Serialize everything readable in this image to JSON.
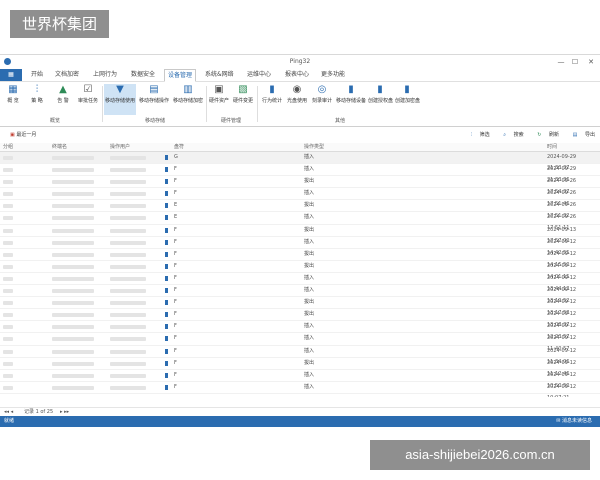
{
  "watermark_top": "世界杯集团",
  "watermark_bottom": "asia-shijiebei2026.com.cn",
  "window": {
    "title": "Ping32",
    "minimize": "—",
    "maximize": "☐",
    "close": "✕"
  },
  "menu": {
    "file_icon": "grid-icon",
    "tabs": [
      "开始",
      "文档加密",
      "上网行为",
      "数据安全",
      "设备管理",
      "系统&网络",
      "运维中心",
      "报表中心",
      "更多功能"
    ]
  },
  "ribbon": {
    "buttons": [
      {
        "label": "概 览",
        "icon": "▦",
        "color": "#2b6cb0"
      },
      {
        "label": "策 略",
        "icon": "⫶",
        "color": "#2b6cb0"
      },
      {
        "label": "告 警",
        "icon": "▲",
        "color": "#2e8b57"
      },
      {
        "label": "审批任务",
        "icon": "☑",
        "color": "#555555"
      },
      {
        "label": "移动存储使用",
        "icon": "▼",
        "color": "#2b6cb0"
      },
      {
        "label": "移动存储操作",
        "icon": "▤",
        "color": "#2b6cb0"
      },
      {
        "label": "移动存储加密",
        "icon": "▥",
        "color": "#2b6cb0"
      },
      {
        "label": "硬件资产",
        "icon": "▣",
        "color": "#555555"
      },
      {
        "label": "硬件变更",
        "icon": "▧",
        "color": "#2e8b57"
      },
      {
        "label": "行为统计",
        "icon": "▮",
        "color": "#2b6cb0"
      },
      {
        "label": "光盘使用",
        "icon": "◉",
        "color": "#555555"
      },
      {
        "label": "刻录审计",
        "icon": "◎",
        "color": "#2b6cb0"
      },
      {
        "label": "移动存储设备",
        "icon": "▮",
        "color": "#2b6cb0"
      },
      {
        "label": "创建授权盘",
        "icon": "▮",
        "color": "#2b6cb0"
      },
      {
        "label": "创建加密盘",
        "icon": "▮",
        "color": "#2b6cb0"
      }
    ],
    "groups": [
      "概览",
      "移动存储",
      "硬件管理",
      "其他"
    ]
  },
  "toolbar": {
    "recent": "最近一月",
    "filter": "筛选",
    "search": "搜索",
    "refresh": "刷新",
    "export": "导出"
  },
  "columns": [
    "分组",
    "终端名",
    "操作用户",
    "盘符",
    "操作类型",
    "时间"
  ],
  "rows": [
    {
      "mark": "G",
      "type": "插入",
      "time": "2024-09-29 21:33:37"
    },
    {
      "mark": "F",
      "type": "插入",
      "time": "2024-09-29 21:33:36"
    },
    {
      "mark": "F",
      "type": "拔出",
      "time": "2024-09-26 17:54:37"
    },
    {
      "mark": "F",
      "type": "插入",
      "time": "2024-09-26 17:51:46"
    },
    {
      "mark": "E",
      "type": "拔出",
      "time": "2024-09-26 17:51:32"
    },
    {
      "mark": "E",
      "type": "插入",
      "time": "2024-09-26 17:51:11"
    },
    {
      "mark": "F",
      "type": "拔出",
      "time": "2024-09-13 17:57:00"
    },
    {
      "mark": "F",
      "type": "插入",
      "time": "2024-09-12 14:42:55"
    },
    {
      "mark": "F",
      "type": "拔出",
      "time": "2024-09-12 14:15:50"
    },
    {
      "mark": "F",
      "type": "拔出",
      "time": "2024-09-12 14:01:15"
    },
    {
      "mark": "F",
      "type": "插入",
      "time": "2024-09-12 13:44:13"
    },
    {
      "mark": "F",
      "type": "插入",
      "time": "2024-09-12 13:19:52"
    },
    {
      "mark": "F",
      "type": "拔出",
      "time": "2024-09-12 13:17:58"
    },
    {
      "mark": "F",
      "type": "拔出",
      "time": "2024-09-12 13:08:37"
    },
    {
      "mark": "F",
      "type": "插入",
      "time": "2024-09-12 12:23:57"
    },
    {
      "mark": "F",
      "type": "插入",
      "time": "2024-09-12 11:40:57"
    },
    {
      "mark": "F",
      "type": "插入",
      "time": "2024-09-12 11:34:06"
    },
    {
      "mark": "F",
      "type": "拔出",
      "time": "2024-09-12 11:12:46"
    },
    {
      "mark": "F",
      "type": "插入",
      "time": "2024-09-12 10:50:50"
    },
    {
      "mark": "F",
      "type": "插入",
      "time": "2024-09-12 10:07:21"
    }
  ],
  "pager": {
    "text": "记录 1 of 25",
    "controls": "◂◂ ◂  ▸ ▸▸"
  },
  "status": {
    "left": "就绪",
    "right": "消息未读信息"
  }
}
